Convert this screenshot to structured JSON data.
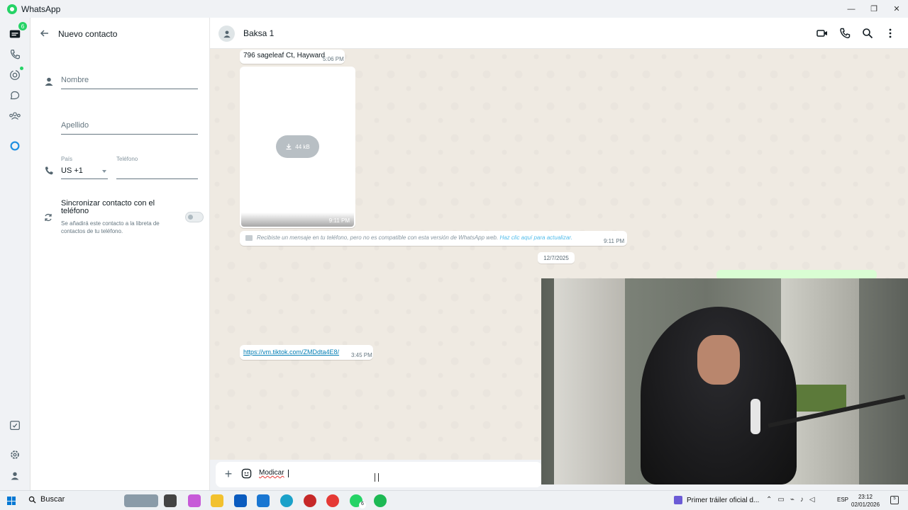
{
  "window": {
    "title": "WhatsApp",
    "controls": {
      "minimize": "—",
      "maximize": "❐",
      "close": "✕"
    }
  },
  "rail": {
    "chats_badge": "6",
    "icons": [
      "chats-icon",
      "calls-icon",
      "status-icon",
      "channels-icon",
      "communities-icon",
      "meta-ai-icon",
      "starred-icon",
      "settings-icon",
      "profile-icon"
    ]
  },
  "contact_panel": {
    "title": "Nuevo contacto",
    "first_name_placeholder": "Nombre",
    "last_name_placeholder": "Apellido",
    "country_label": "País",
    "country_value": "US +1",
    "phone_label": "Teléfono",
    "phone_value": "",
    "sync_title": "Sincronizar contacto con el teléfono",
    "sync_description": "Se añadirá este contacto a la libreta de contactos de tu teléfono.",
    "sync_enabled": false
  },
  "chat": {
    "name": "Baksa 1",
    "messages": {
      "address_text": "796 sageleaf Ct, Hayward",
      "address_time": "5:06 PM",
      "media_size": "44 kB",
      "media_time": "9:11 PM",
      "system_text": "Recibiste un mensaje en tu teléfono, pero no es compatible con esta versión de WhatsApp web.",
      "system_link": "Haz clic aquí para actualizar.",
      "system_time": "9:11 PM",
      "date_separator": "12/7/2025",
      "link_url": "https://vm.tiktok.com/ZMDdta4E8/",
      "link_time": "3:45 PM"
    },
    "composer_text": "Modicar"
  },
  "taskbar": {
    "search_label": "Buscar",
    "whatsapp_badge": "6",
    "news_text": "Primer tráiler oficial d...",
    "language": "ESP",
    "time": "23:12",
    "date": "02/01/2026",
    "notifications": "5"
  },
  "colors": {
    "accent": "#25d366",
    "chat_background": "#efeae2",
    "link": "#027eb5",
    "outgoing_bubble": "#d9fdd3"
  }
}
